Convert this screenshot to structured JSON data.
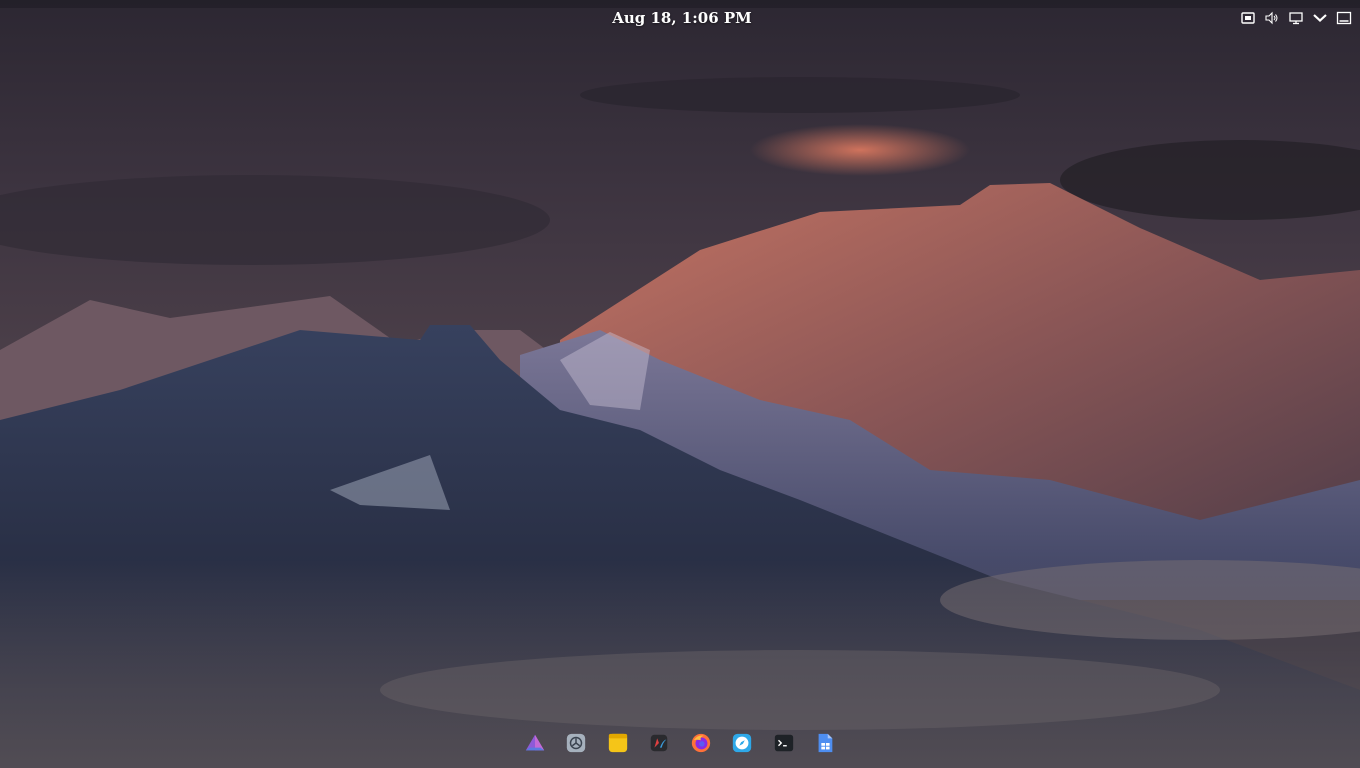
{
  "panel": {
    "clock": "Aug 18, 1:06 PM",
    "tray_icons": [
      "screenshot-icon",
      "volume-icon",
      "display-icon",
      "chevron-down-icon",
      "window-icon"
    ]
  },
  "dock": {
    "apps": [
      {
        "icon": "prism-app-icon"
      },
      {
        "icon": "settings-app-icon"
      },
      {
        "icon": "notes-app-icon"
      },
      {
        "icon": "dark-app-icon"
      },
      {
        "icon": "firefox-icon"
      },
      {
        "icon": "compass-app-icon"
      },
      {
        "icon": "terminal-icon"
      },
      {
        "icon": "document-app-icon"
      }
    ]
  },
  "colors": {
    "accent_orange": "#d9785a",
    "sky_dark": "#2c2534",
    "mountain_blue": "#2d3650"
  }
}
